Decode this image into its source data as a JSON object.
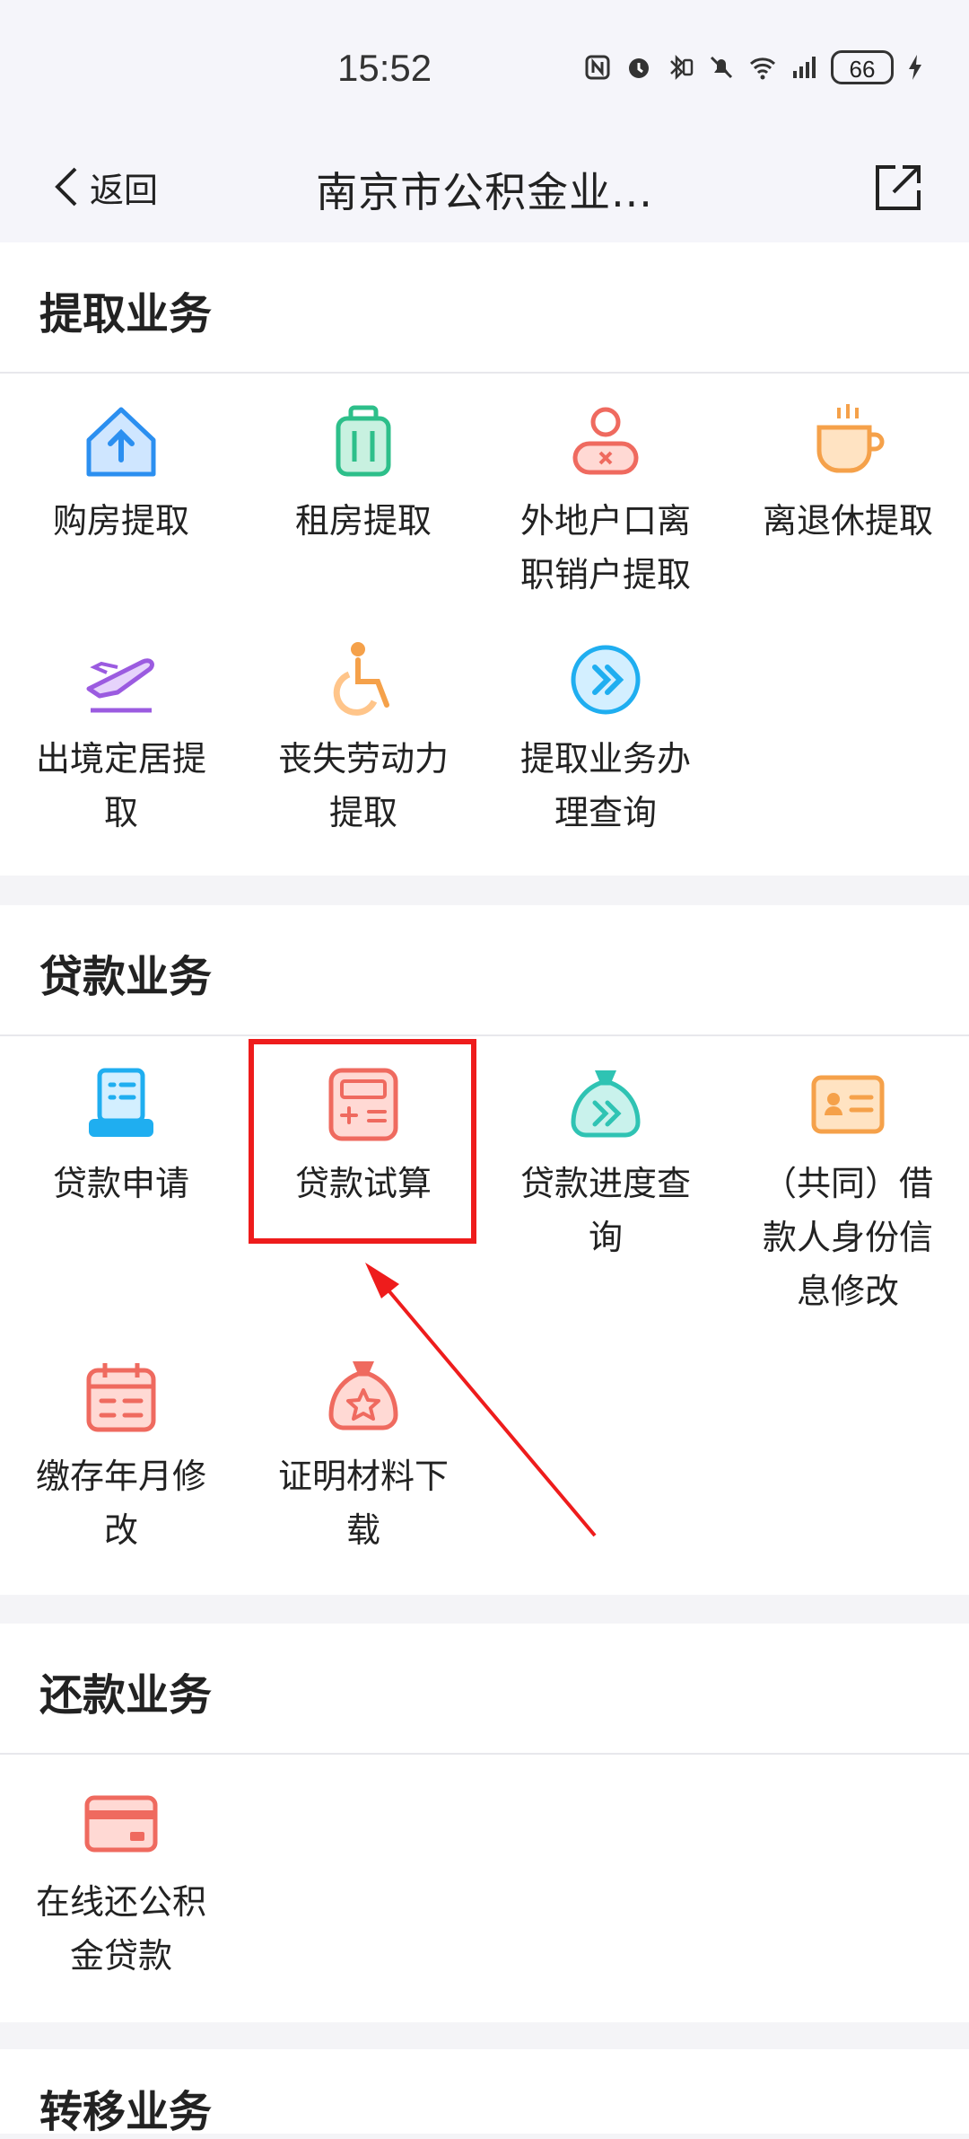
{
  "status": {
    "time": "15:52",
    "battery": "66"
  },
  "nav": {
    "back_label": "返回",
    "title": "南京市公积金业..."
  },
  "sections": [
    {
      "title": "提取业务",
      "items": [
        {
          "label": "购房提取",
          "icon": "house-upload-icon"
        },
        {
          "label": "租房提取",
          "icon": "luggage-icon"
        },
        {
          "label": "外地户口离职销户提取",
          "icon": "person-cancel-icon"
        },
        {
          "label": "离退休提取",
          "icon": "tea-cup-icon"
        },
        {
          "label": "出境定居提取",
          "icon": "airplane-icon"
        },
        {
          "label": "丧失劳动力提取",
          "icon": "wheelchair-icon"
        },
        {
          "label": "提取业务办理查询",
          "icon": "double-chevron-icon"
        }
      ]
    },
    {
      "title": "贷款业务",
      "items": [
        {
          "label": "贷款申请",
          "icon": "document-apply-icon"
        },
        {
          "label": "贷款试算",
          "icon": "calculator-icon"
        },
        {
          "label": "贷款进度查询",
          "icon": "money-bag-progress-icon"
        },
        {
          "label": "（共同）借款人身份信息修改",
          "icon": "id-card-icon"
        },
        {
          "label": "缴存年月修改",
          "icon": "calendar-icon"
        },
        {
          "label": "证明材料下载",
          "icon": "star-bag-icon"
        }
      ]
    },
    {
      "title": "还款业务",
      "items": [
        {
          "label": "在线还公积金贷款",
          "icon": "bank-card-icon"
        }
      ]
    },
    {
      "title": "转移业务",
      "items": []
    }
  ],
  "colors": {
    "highlight": "#ee1c1c",
    "blue": "#2b8ff0",
    "green": "#2dbf8a",
    "red": "#ef6a5f",
    "orange": "#f5a14a",
    "purple": "#9b5be0",
    "teal": "#2fc3b3"
  }
}
